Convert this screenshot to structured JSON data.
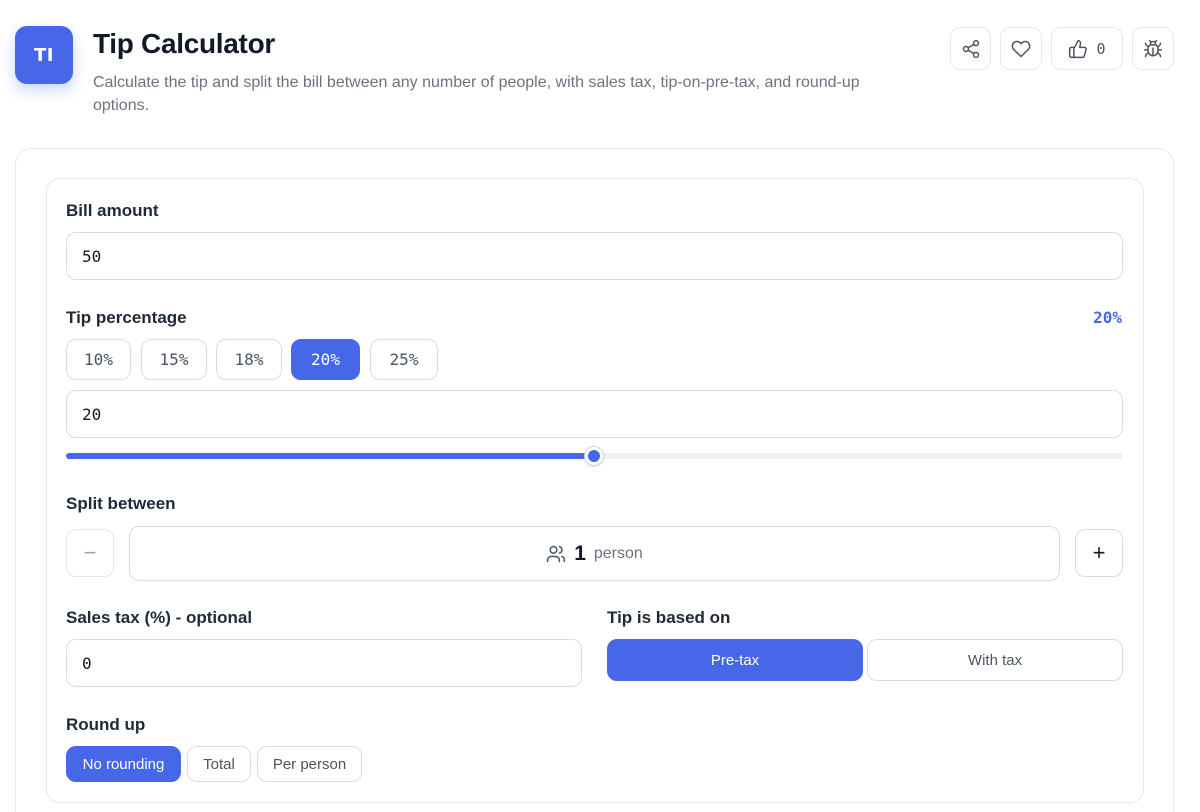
{
  "header": {
    "logo_text": "TI",
    "title": "Tip Calculator",
    "subtitle": "Calculate the tip and split the bill between any number of people, with sales tax, tip-on-pre-tax, and round-up options.",
    "like_count": "0",
    "icons": [
      "share-icon",
      "heart-icon",
      "thumbs-up-icon",
      "bug-icon"
    ]
  },
  "bill": {
    "label": "Bill amount",
    "value": "50"
  },
  "tip": {
    "label": "Tip percentage",
    "display": "20%",
    "presets": [
      "10%",
      "15%",
      "18%",
      "20%",
      "25%"
    ],
    "selected_preset": "20%",
    "input_value": "20",
    "slider_fraction": 0.5
  },
  "split": {
    "label": "Split between",
    "minus": "−",
    "plus": "+",
    "count": "1",
    "unit": "person"
  },
  "tax": {
    "label": "Sales tax (%) - optional",
    "value": "0"
  },
  "tip_basis": {
    "label": "Tip is based on",
    "options": [
      "Pre-tax",
      "With tax"
    ],
    "selected": "Pre-tax"
  },
  "round_up": {
    "label": "Round up",
    "options": [
      "No rounding",
      "Total",
      "Per person"
    ],
    "selected": "No rounding"
  },
  "colors": {
    "accent": "#4567e8",
    "border": "#d9dde3",
    "muted_text": "#6b7280"
  }
}
